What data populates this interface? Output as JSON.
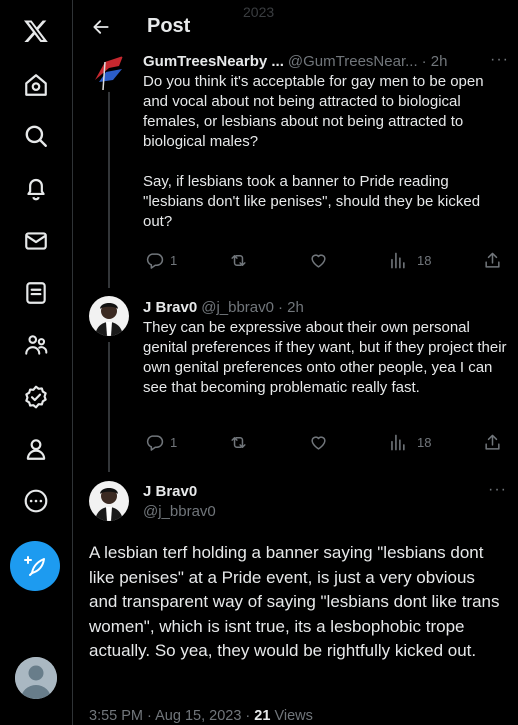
{
  "header": {
    "title": "Post",
    "ghost_text": "2023"
  },
  "replies": [
    {
      "name": "GumTreesNearby ...",
      "handle": "@GumTreesNear...",
      "time": "· 2h",
      "text": "Do you think it's acceptable for gay men to be open and vocal about not being attracted to biological females, or lesbians about not being attracted to biological males?\n\nSay, if lesbians took a banner to Pride reading \"lesbians don't like penises\", should they be kicked out?",
      "replies": "1",
      "reposts": "",
      "likes": "",
      "views": "18"
    },
    {
      "name": "J Brav0",
      "handle": "@j_bbrav0",
      "time": "· 2h",
      "text": "They can be expressive about their own personal genital preferences if they want, but if they project their own genital preferences onto other people, yea I can see that becoming problematic really fast.",
      "replies": "1",
      "reposts": "",
      "likes": "",
      "views": "18"
    }
  ],
  "main_post": {
    "name": "J Brav0",
    "handle": "@j_bbrav0",
    "text": "A lesbian terf holding a banner saying \"lesbians dont like penises\" at a Pride event, is just a very obvious and transparent way of saying \"lesbians dont like trans women\", which is isnt true, its a lesbophobic trope actually. So yea, they would be rightfully kicked out.",
    "time": "3:55 PM",
    "sep": "·",
    "date": "Aug 15, 2023",
    "views_count": "21",
    "views_label": "Views"
  },
  "more_label": "···",
  "colors": {
    "accent": "#1d9bf0",
    "text": "#e7e9ea",
    "muted": "#71767b",
    "border": "#2f3336"
  }
}
